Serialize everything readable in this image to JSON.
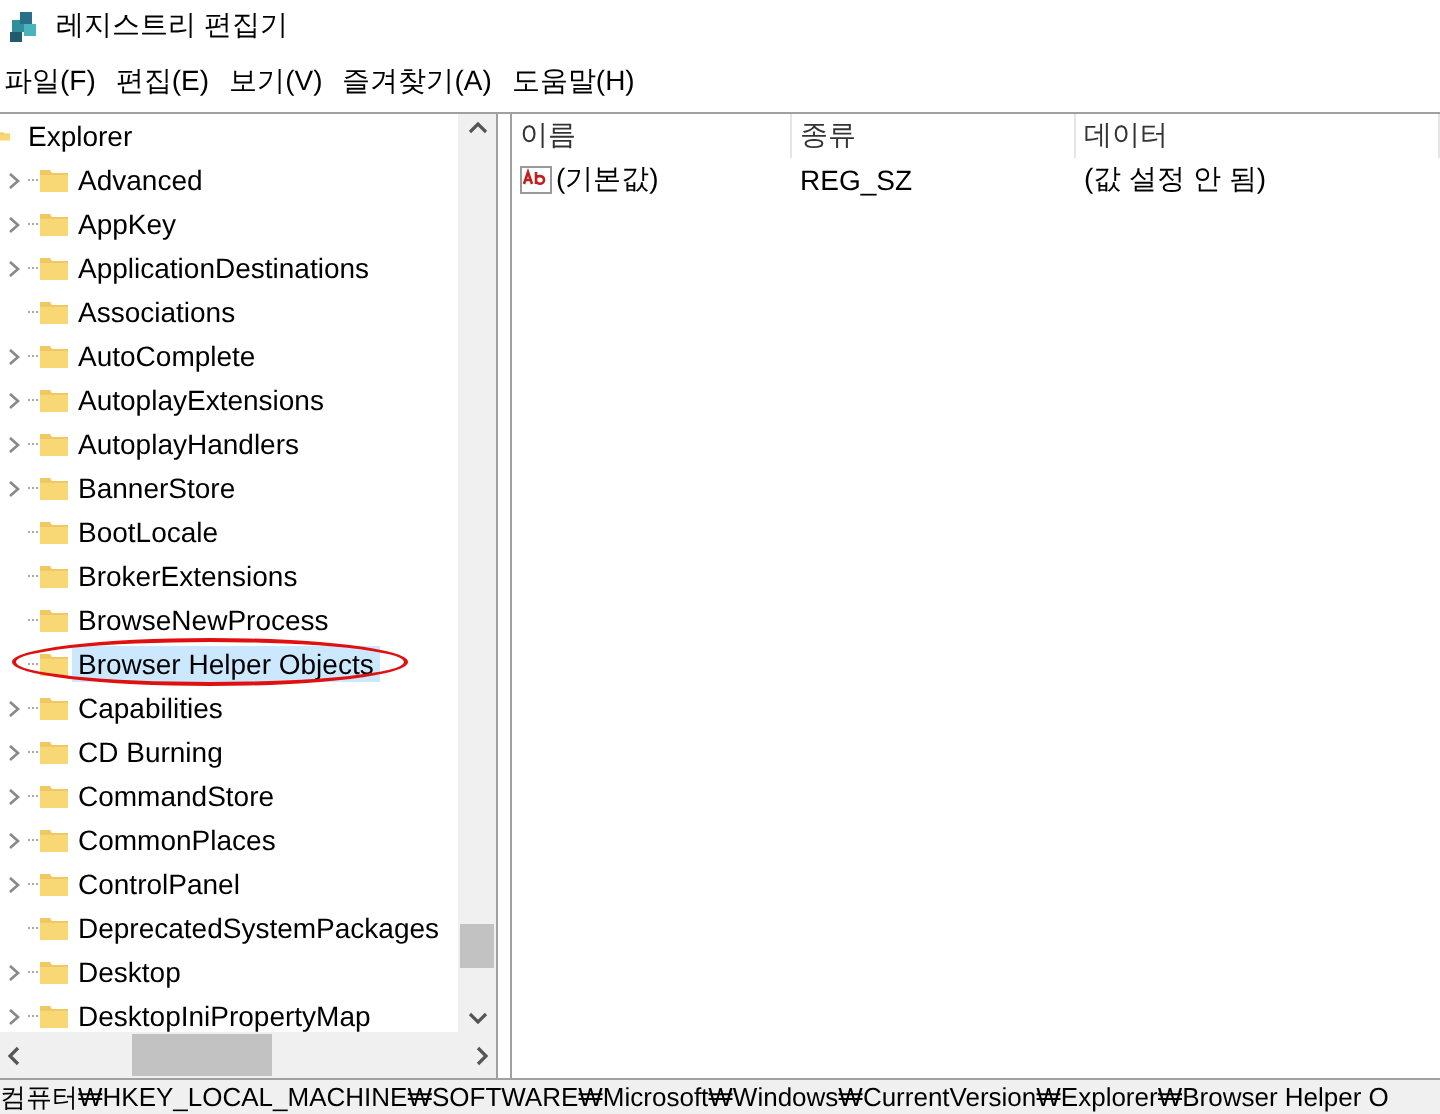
{
  "window": {
    "title": "레지스트리 편집기"
  },
  "menu": [
    "파일(F)",
    "편집(E)",
    "보기(V)",
    "즐겨찾기(A)",
    "도움말(H)"
  ],
  "tree": {
    "label": "Explorer",
    "children": [
      {
        "label": "Advanced",
        "expandable": true,
        "selected": false
      },
      {
        "label": "AppKey",
        "expandable": true,
        "selected": false
      },
      {
        "label": "ApplicationDestinations",
        "expandable": true,
        "selected": false
      },
      {
        "label": "Associations",
        "expandable": false,
        "selected": false
      },
      {
        "label": "AutoComplete",
        "expandable": true,
        "selected": false
      },
      {
        "label": "AutoplayExtensions",
        "expandable": true,
        "selected": false
      },
      {
        "label": "AutoplayHandlers",
        "expandable": true,
        "selected": false
      },
      {
        "label": "BannerStore",
        "expandable": true,
        "selected": false
      },
      {
        "label": "BootLocale",
        "expandable": false,
        "selected": false
      },
      {
        "label": "BrokerExtensions",
        "expandable": false,
        "selected": false
      },
      {
        "label": "BrowseNewProcess",
        "expandable": false,
        "selected": false
      },
      {
        "label": "Browser Helper Objects",
        "expandable": false,
        "selected": true,
        "circled": true
      },
      {
        "label": "Capabilities",
        "expandable": true,
        "selected": false
      },
      {
        "label": "CD Burning",
        "expandable": true,
        "selected": false
      },
      {
        "label": "CommandStore",
        "expandable": true,
        "selected": false
      },
      {
        "label": "CommonPlaces",
        "expandable": true,
        "selected": false
      },
      {
        "label": "ControlPanel",
        "expandable": true,
        "selected": false
      },
      {
        "label": "DeprecatedSystemPackages",
        "expandable": false,
        "selected": false
      },
      {
        "label": "Desktop",
        "expandable": true,
        "selected": false
      },
      {
        "label": "DesktopIniPropertyMap",
        "expandable": true,
        "selected": false
      }
    ]
  },
  "table": {
    "columns": [
      "이름",
      "종류",
      "데이터"
    ],
    "rows": [
      {
        "name": "(기본값)",
        "type": "REG_SZ",
        "data": "(값 설정 안 됨)"
      }
    ]
  },
  "status_bar": "컴퓨터₩HKEY_LOCAL_MACHINE₩SOFTWARE₩Microsoft₩Windows₩CurrentVersion₩Explorer₩Browser Helper O"
}
